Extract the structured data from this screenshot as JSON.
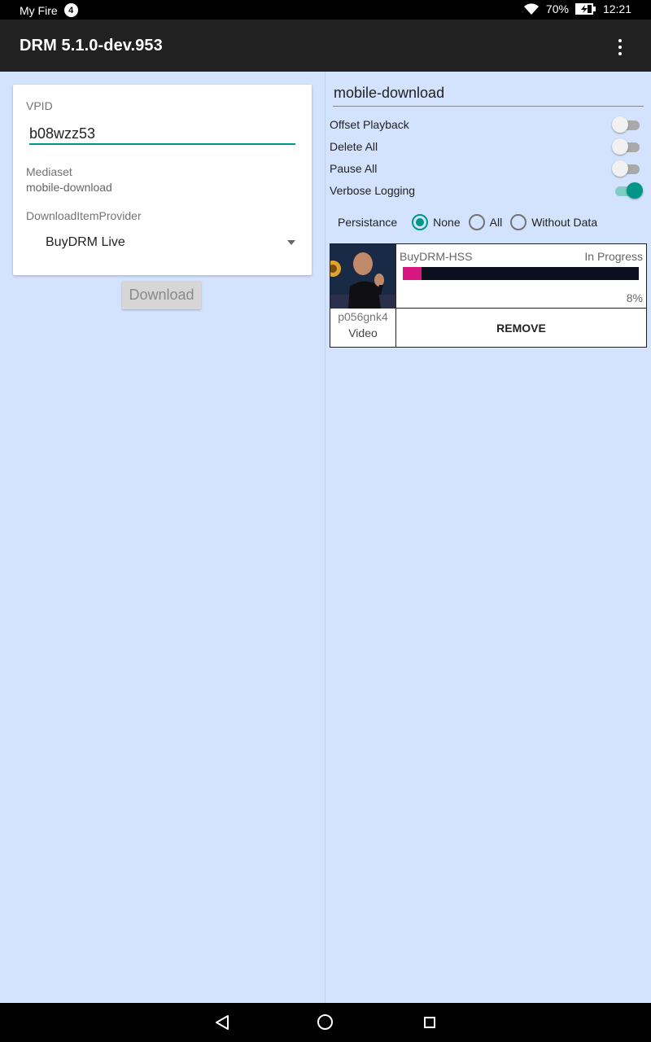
{
  "status_bar": {
    "carrier": "My Fire",
    "notification_count": "4",
    "battery": "70%",
    "time": "12:21"
  },
  "app_bar": {
    "title": "DRM 5.1.0-dev.953",
    "menu_icon": "overflow-menu-icon"
  },
  "left": {
    "vpid_label": "VPID",
    "vpid_value": "b08wzz53",
    "mediaset_label": "Mediaset",
    "mediaset_value": "mobile-download",
    "provider_label": "DownloadItemProvider",
    "provider_value": "BuyDRM Live",
    "download_button": "Download"
  },
  "right": {
    "mediaset_input": "mobile-download",
    "switches": [
      {
        "label": "Offset Playback",
        "on": false
      },
      {
        "label": "Delete All",
        "on": false
      },
      {
        "label": "Pause All",
        "on": false
      },
      {
        "label": "Verbose Logging",
        "on": true
      }
    ],
    "persistance_label": "Persistance",
    "persistance_options": [
      {
        "label": "None",
        "checked": true
      },
      {
        "label": "All",
        "checked": false
      },
      {
        "label": "Without Data",
        "checked": false
      }
    ],
    "item": {
      "provider": "BuyDRM-HSS",
      "status": "In Progress",
      "progress": 8,
      "progress_label": "8%",
      "vpid": "p056gnk4",
      "kind": "Video",
      "remove_label": "REMOVE"
    }
  },
  "colors": {
    "accent": "#009688",
    "progress_fill": "#d7177f",
    "background": "#d4e3fd",
    "app_bar": "#212121"
  }
}
